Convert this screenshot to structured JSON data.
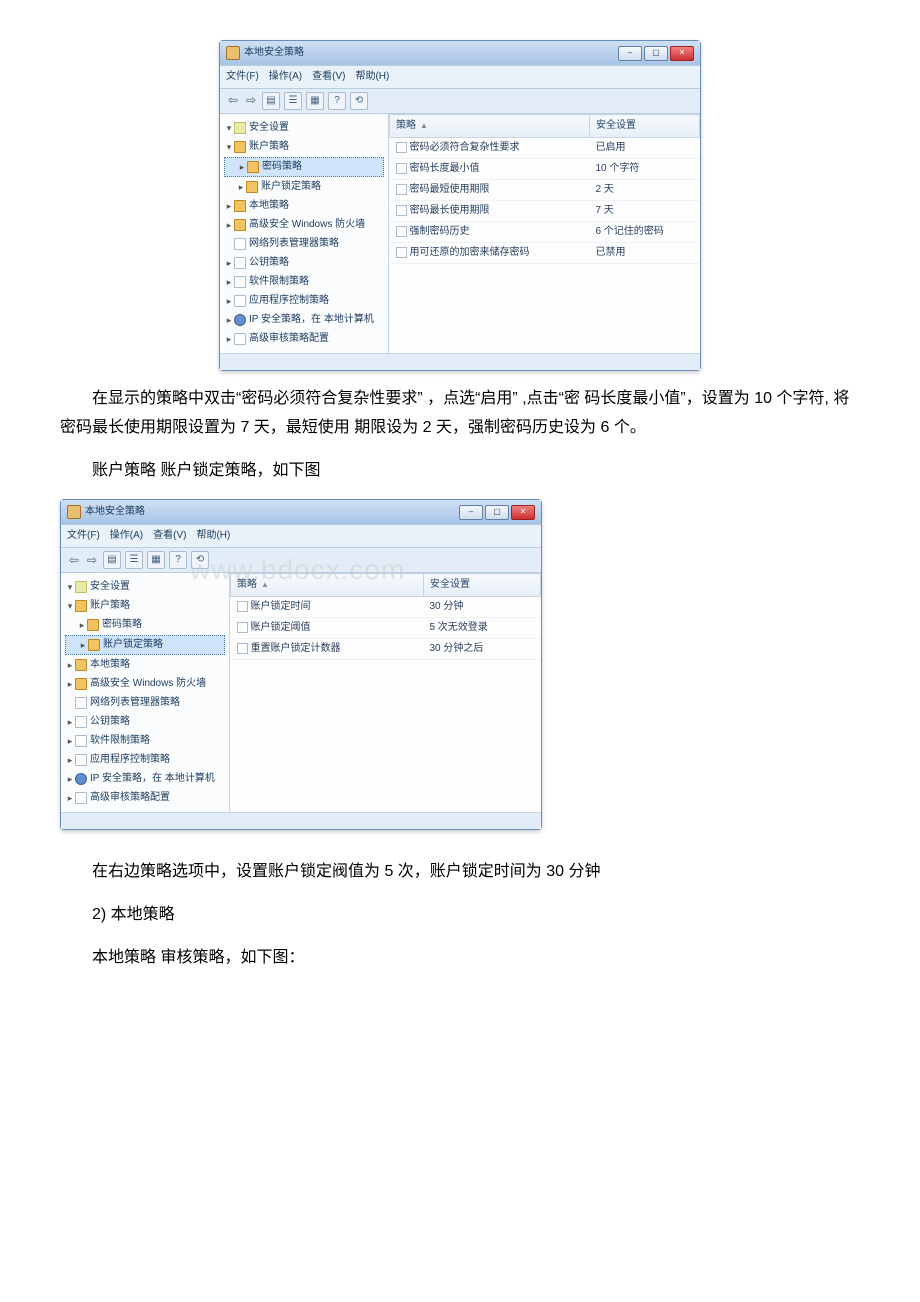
{
  "win1": {
    "title": "本地安全策略",
    "menu": [
      "文件(F)",
      "操作(A)",
      "查看(V)",
      "帮助(H)"
    ],
    "tree_root": "安全设置",
    "tree": [
      {
        "label": "账户策略",
        "icon": "fld",
        "expand": "▾",
        "indent": 0
      },
      {
        "label": "密码策略",
        "icon": "fld",
        "expand": "▸",
        "indent": 1,
        "sel": true
      },
      {
        "label": "账户锁定策略",
        "icon": "fld",
        "expand": "▸",
        "indent": 1
      },
      {
        "label": "本地策略",
        "icon": "fld",
        "expand": "▸",
        "indent": 0
      },
      {
        "label": "高级安全 Windows 防火墙",
        "icon": "fld",
        "expand": "▸",
        "indent": 0
      },
      {
        "label": "网络列表管理器策略",
        "icon": "pg",
        "expand": "",
        "indent": 0
      },
      {
        "label": "公钥策略",
        "icon": "pg",
        "expand": "▸",
        "indent": 0
      },
      {
        "label": "软件限制策略",
        "icon": "pg",
        "expand": "▸",
        "indent": 0
      },
      {
        "label": "应用程序控制策略",
        "icon": "pg",
        "expand": "▸",
        "indent": 0
      },
      {
        "label": "IP 安全策略，在 本地计算机",
        "icon": "net",
        "expand": "▸",
        "indent": 0
      },
      {
        "label": "高级审核策略配置",
        "icon": "pg",
        "expand": "▸",
        "indent": 0
      }
    ],
    "cols": [
      "策略",
      "安全设置"
    ],
    "rows": [
      {
        "p": "密码必须符合复杂性要求",
        "v": "已启用"
      },
      {
        "p": "密码长度最小值",
        "v": "10 个字符"
      },
      {
        "p": "密码最短使用期限",
        "v": "2 天"
      },
      {
        "p": "密码最长使用期限",
        "v": "7 天"
      },
      {
        "p": "强制密码历史",
        "v": "6 个记住的密码"
      },
      {
        "p": "用可还原的加密来储存密码",
        "v": "已禁用"
      }
    ]
  },
  "para1": "在显示的策略中双击“密码必须符合复杂性要求” ，点选“启用” ,点击“密 码长度最小值”，设置为 10 个字符, 将密码最长使用期限设置为 7 天，最短使用 期限设为 2 天，强制密码历史设为 6 个。",
  "para2": "账户策略 账户锁定策略，如下图",
  "win2": {
    "title": "本地安全策略",
    "menu": [
      "文件(F)",
      "操作(A)",
      "查看(V)",
      "帮助(H)"
    ],
    "tree_root": "安全设置",
    "tree": [
      {
        "label": "账户策略",
        "icon": "fld",
        "expand": "▾",
        "indent": 0
      },
      {
        "label": "密码策略",
        "icon": "fld",
        "expand": "▸",
        "indent": 1
      },
      {
        "label": "账户锁定策略",
        "icon": "fld",
        "expand": "▸",
        "indent": 1,
        "sel": true
      },
      {
        "label": "本地策略",
        "icon": "fld",
        "expand": "▸",
        "indent": 0
      },
      {
        "label": "高级安全 Windows 防火墙",
        "icon": "fld",
        "expand": "▸",
        "indent": 0
      },
      {
        "label": "网络列表管理器策略",
        "icon": "pg",
        "expand": "",
        "indent": 0
      },
      {
        "label": "公钥策略",
        "icon": "pg",
        "expand": "▸",
        "indent": 0
      },
      {
        "label": "软件限制策略",
        "icon": "pg",
        "expand": "▸",
        "indent": 0
      },
      {
        "label": "应用程序控制策略",
        "icon": "pg",
        "expand": "▸",
        "indent": 0
      },
      {
        "label": "IP 安全策略，在 本地计算机",
        "icon": "net",
        "expand": "▸",
        "indent": 0
      },
      {
        "label": "高级审核策略配置",
        "icon": "pg",
        "expand": "▸",
        "indent": 0
      }
    ],
    "cols": [
      "策略",
      "安全设置"
    ],
    "rows": [
      {
        "p": "账户锁定时间",
        "v": "30 分钟"
      },
      {
        "p": "账户锁定阈值",
        "v": "5 次无效登录"
      },
      {
        "p": "重置账户锁定计数器",
        "v": "30 分钟之后"
      }
    ]
  },
  "watermark": "www.bdocx.com",
  "para3": "在右边策略选项中，设置账户锁定阀值为 5 次，账户锁定时间为 30 分钟",
  "para4": "2) 本地策略",
  "para5": "本地策略 审核策略，如下图："
}
